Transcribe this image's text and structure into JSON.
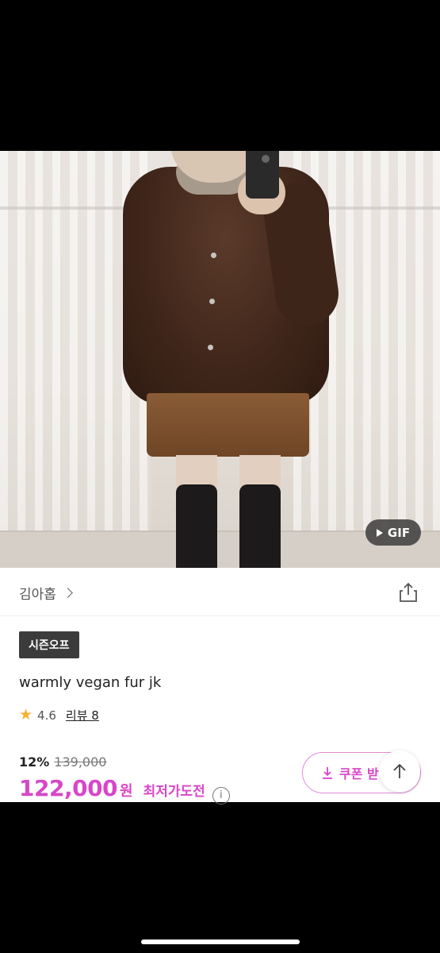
{
  "media": {
    "badge_label": "GIF"
  },
  "store": {
    "name": "김아홉"
  },
  "product": {
    "tag": "시즌오프",
    "title": "warmly vegan fur jk",
    "rating": "4.6",
    "review_label": "리뷰 8",
    "discount_percent": "12%",
    "original_price": "139,000",
    "price": "122,000",
    "currency": "원",
    "lowest_price_label": "최저가도전"
  },
  "actions": {
    "coupon_label": "쿠폰 받"
  },
  "colors": {
    "accent": "#d946c8",
    "star": "#f4b233",
    "tag_bg": "#3b3b3b"
  },
  "icons": [
    "play-icon",
    "chevron-right-icon",
    "share-icon",
    "star-icon",
    "info-icon",
    "download-icon",
    "arrow-up-icon"
  ]
}
